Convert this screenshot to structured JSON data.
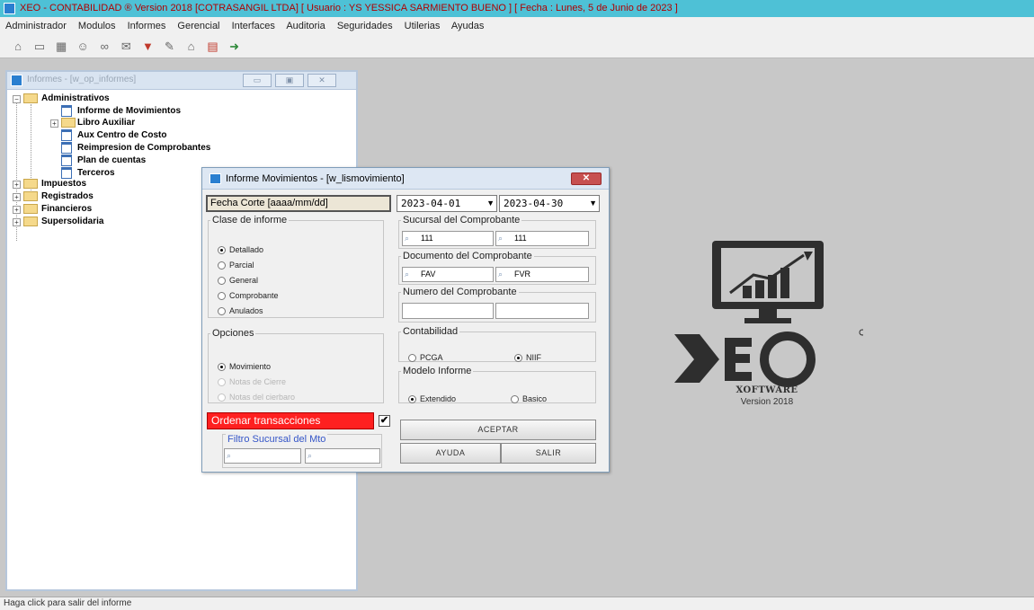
{
  "window": {
    "title": "XEO - CONTABILIDAD ® Version 2018 [COTRASANGIL LTDA] [ Usuario : YS YESSICA SARMIENTO BUENO ] [ Fecha : Lunes, 5 de Junio de 2023 ]"
  },
  "menu": [
    "Administrador",
    "Modulos",
    "Informes",
    "Gerencial",
    "Interfaces",
    "Auditoria",
    "Seguridades",
    "Utilerias",
    "Ayudas"
  ],
  "toolbar_icons": [
    "bank-icon",
    "card-icon",
    "grid-icon",
    "users-icon",
    "link-icon",
    "chat-icon",
    "filter-icon",
    "report-icon",
    "home-icon",
    "table-icon",
    "exit-icon"
  ],
  "tree_window": {
    "title": "Informes - [w_op_informes]",
    "minimize": "▭",
    "restore": "▣",
    "close": "✕"
  },
  "tree": {
    "administrativos": "Administrativos",
    "informe_movimientos": "Informe de Movimientos",
    "libro_auxiliar": "Libro Auxiliar",
    "aux_centro_costo": "Aux Centro de Costo",
    "reimpresion": "Reimpresion de Comprobantes",
    "plan_cuentas": "Plan de cuentas",
    "terceros": "Terceros",
    "impuestos": "Impuestos",
    "registrados": "Registrados",
    "financieros": "Financieros",
    "supersolidaria": "Supersolidaria"
  },
  "dialog": {
    "title": "Informe Movimientos - [w_lismovimiento]",
    "close": "✕",
    "fecha_label": "Fecha  Corte [aaaa/mm/dd]",
    "date_from": "2023-04-01",
    "date_to": "2023-04-30",
    "clase_title": "Clase de informe",
    "clase_options": [
      "Detallado",
      "Parcial",
      "General",
      "Comprobante",
      "Anulados"
    ],
    "clase_selected": "Detallado",
    "sucursal_title": "Sucursal del Comprobante",
    "sucursal_from": "111",
    "sucursal_to": "111",
    "documento_title": "Documento del Comprobante",
    "documento_from": "FAV",
    "documento_to": "FVR",
    "numero_title": "Numero del Comprobante",
    "opciones_title": "Opciones",
    "opciones": [
      "Movimiento",
      "Notas de Cierre",
      "Notas del cierbaro"
    ],
    "contabilidad_title": "Contabilidad",
    "contabilidad_options": [
      "PCGA",
      "NIIF"
    ],
    "contabilidad_selected": "NIIF",
    "modelo_title": "Modelo Informe",
    "modelo_options": [
      "Extendido",
      "Basico"
    ],
    "modelo_selected": "Extendido",
    "ordenar_label": "Ordenar transacciones",
    "ordenar_checked": "✔",
    "filtro_title": "Filtro Sucursal del Mto",
    "aceptar": "ACEPTAR",
    "ayuda": "AYUDA",
    "salir": "SALIR"
  },
  "logo": {
    "brand": "XOFTWARE",
    "version": "Version 2018"
  },
  "status": "Haga click para salir del informe",
  "colors": {
    "titlebar": "#4ec1d6",
    "title_text": "#b00000",
    "order_box": "#ff2020",
    "filtro_text": "#3556c8"
  }
}
